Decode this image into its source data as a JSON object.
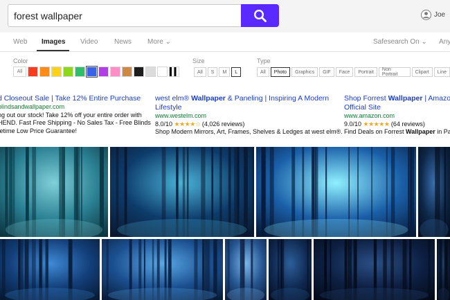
{
  "search": {
    "query": "forest wallpaper"
  },
  "user": {
    "name": "Joe"
  },
  "tabs": [
    {
      "label": "Web"
    },
    {
      "label": "Images"
    },
    {
      "label": "Video"
    },
    {
      "label": "News"
    },
    {
      "label": "More ⌄"
    }
  ],
  "safesearch": {
    "label": "Safesearch On ⌄"
  },
  "time_filter": {
    "label": "Any"
  },
  "filters": {
    "color": {
      "label": "Color",
      "all_label": "All",
      "swatches": [
        "#ff3b1e",
        "#ff8c1a",
        "#ffd21a",
        "#8fd61e",
        "#2fbf6b",
        "#38c2b4",
        "#3a62e6",
        "#b23ee6",
        "#ff8fc6",
        "#cd8a45",
        "#1d1d1d",
        "#dcdcdc",
        "#bw-gradient"
      ]
    },
    "size": {
      "label": "Size",
      "options": [
        "All",
        "S",
        "M",
        "L"
      ],
      "selected": "L"
    },
    "type": {
      "label": "Type",
      "options": [
        "All",
        "Photo",
        "Graphics",
        "GIF",
        "Face",
        "Portrait",
        "Non Portrait",
        "Clipart",
        "Line"
      ],
      "selected": "Photo"
    }
  },
  "ads": [
    {
      "title": "d Closeout Sale | Take 12% Entire Purchase",
      "url": "blindsandwallpaper.com",
      "lines": [
        "ng out our stock! Take 12% off your entire order with",
        "HEND. Fast Free Shipping - No Sales Tax - Free Blinds",
        "fetime Low Price Guarantee!"
      ]
    },
    {
      "title_pre": "west elm® ",
      "title_bold": "Wallpaper",
      "title_post": " & Paneling | Inspiring A Modern Lifestyle",
      "url": "www.westelm.com",
      "rating": "8.0/10",
      "stars": "★★★★☆",
      "reviews": "(4,026 reviews)",
      "lines": [
        "Shop Modern Mirrors, Art, Frames, Shelves & Ledges at west elm®."
      ]
    },
    {
      "title_pre": "Shop Forrest ",
      "title_bold": "Wallpaper",
      "title_post": " | Amazon Official Site",
      "url": "www.amazon.com",
      "rating": "9.0/10",
      "stars": "★★★★★",
      "reviews": "(64 reviews)",
      "desc_pre": "Find Deals on Forrest ",
      "desc_bold": "Wallpaper",
      "desc_post": " in Pa"
    }
  ],
  "image_results": [
    {
      "kind": "misty-teal-forest",
      "colors": [
        "#7fd0d8",
        "#2a7f92",
        "#0b3642"
      ]
    },
    {
      "kind": "snowy-forest-path",
      "colors": [
        "#4ab3d8",
        "#0d3c6b",
        "#0a1830"
      ]
    },
    {
      "kind": "magical-blue-tree",
      "colors": [
        "#8ff0ff",
        "#1a5fa8",
        "#071a3a"
      ]
    },
    {
      "kind": "dark-blue-edge",
      "colors": [
        "#3a6fb0",
        "#0d2747",
        "#050d1c"
      ]
    },
    {
      "kind": "blue-tall-trees",
      "colors": [
        "#3f8ad6",
        "#123e78",
        "#071a35"
      ]
    },
    {
      "kind": "blue-woods-silhouette",
      "colors": [
        "#5aa8e8",
        "#1a4f8f",
        "#081c3a"
      ]
    },
    {
      "kind": "foggy-blue-trees",
      "colors": [
        "#7ab8ec",
        "#25548f",
        "#0c1f40"
      ]
    },
    {
      "kind": "night-forest-trunks",
      "colors": [
        "#2d5f9a",
        "#102a52",
        "#050c1e"
      ]
    },
    {
      "kind": "dark-pine-night",
      "colors": [
        "#2a4f85",
        "#0d1f42",
        "#040a18"
      ]
    },
    {
      "kind": "deep-navy-forest",
      "colors": [
        "#21406e",
        "#0b1a36",
        "#040913"
      ]
    }
  ]
}
